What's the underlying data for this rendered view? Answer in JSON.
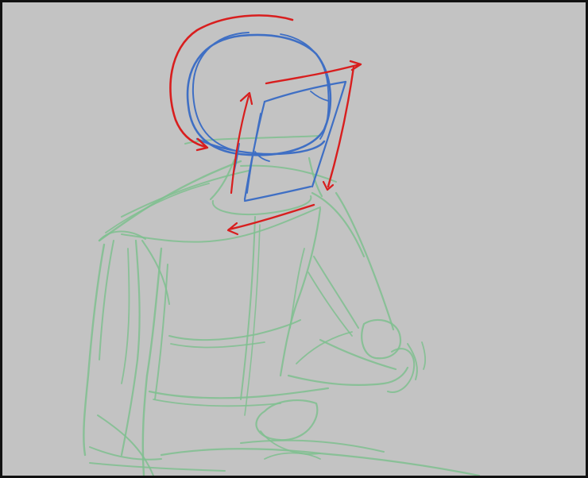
{
  "image": {
    "subject": "sketch",
    "layers": [
      {
        "name": "body-construction",
        "color": "#7fbf8f"
      },
      {
        "name": "head-construction",
        "color": "#3f6fc4"
      },
      {
        "name": "rotation-arrows",
        "color": "#d81e1e"
      }
    ],
    "background_color": "#c3c3c3",
    "border_color": "#111111"
  }
}
